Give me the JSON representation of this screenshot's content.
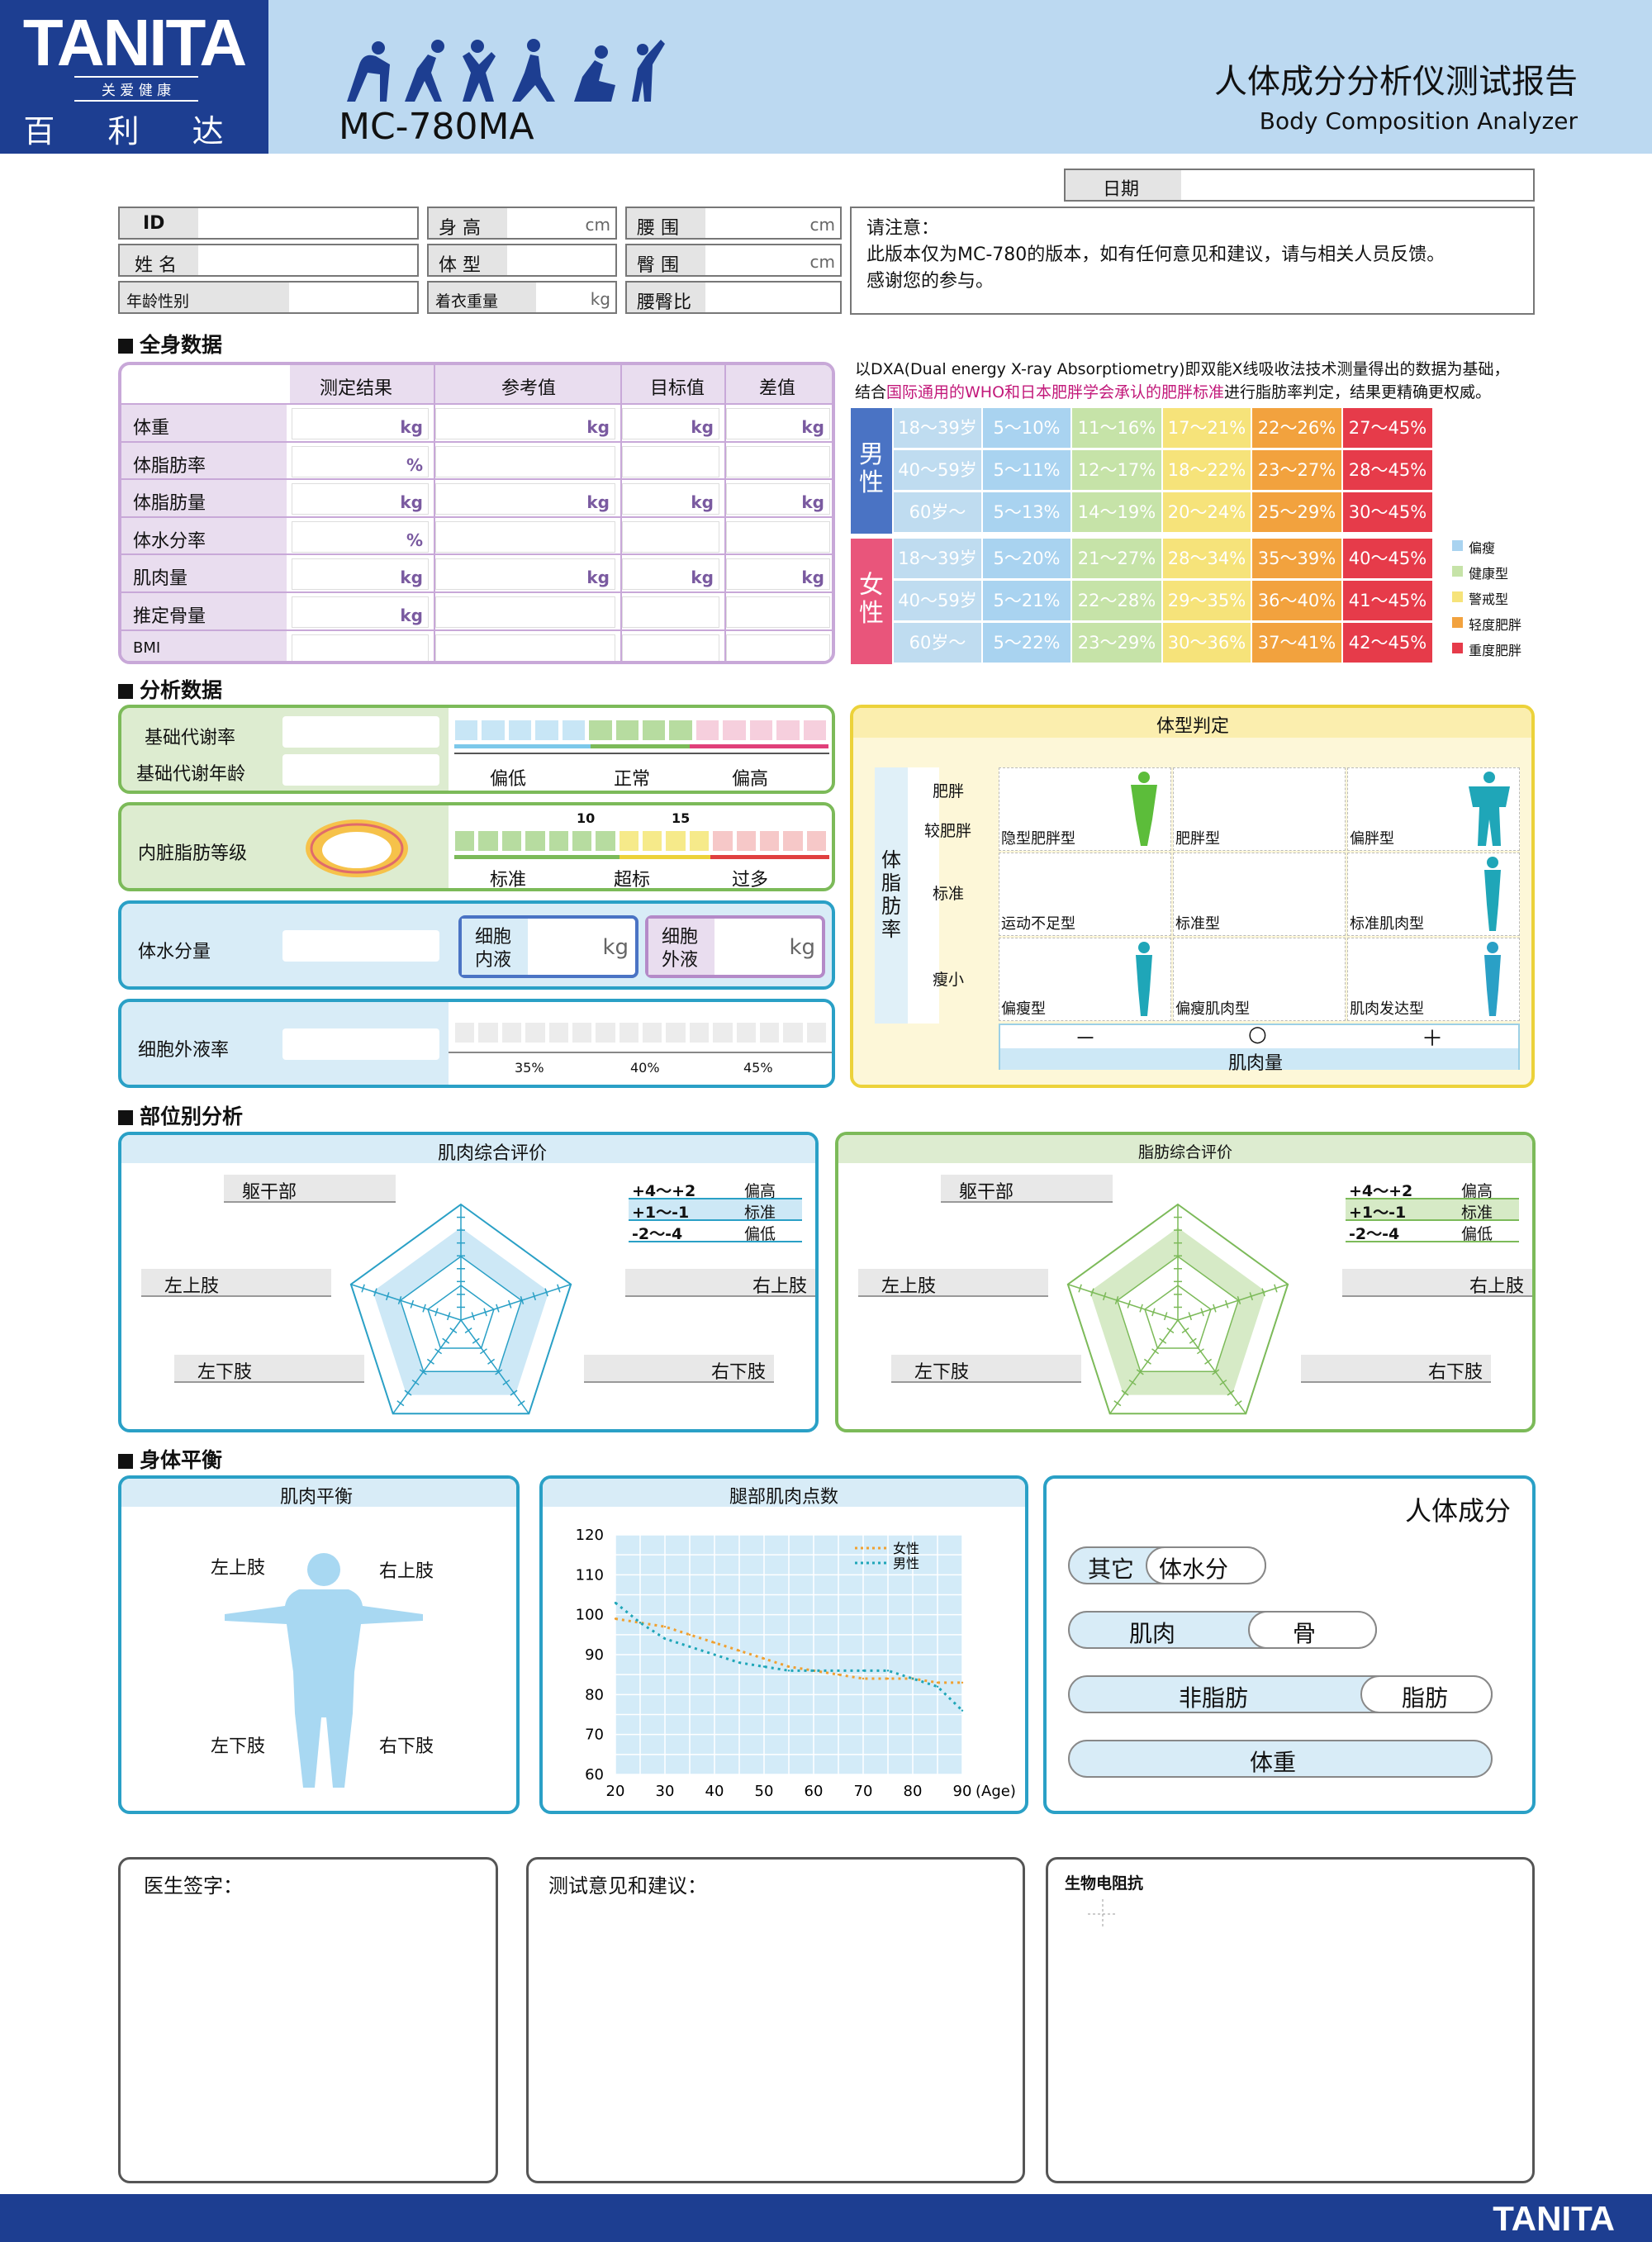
{
  "header": {
    "brand": "TANITA",
    "slogan": "关 爱 健 康",
    "cn_brand": "百 利 达",
    "model": "MC-780MA",
    "title": "人体成分分析仪测试报告",
    "subtitle": "Body Composition Analyzer",
    "footer_brand": "TANITA"
  },
  "colors": {
    "navy": "#1d3e91",
    "header_bg": "#bcd9f1",
    "teal": "#2aa0c6",
    "purple": "#b48ac8",
    "green": "#7cba59",
    "yellow": "#ecd23a",
    "male": "#4a73c4",
    "female": "#e9557b"
  },
  "info": {
    "date": "日期",
    "id": "ID",
    "name": "姓 名",
    "age_sex": "年龄性别",
    "height": "身 高",
    "body_type": "体 型",
    "clothes": "着衣重量",
    "waist": "腰 围",
    "hip": "臀 围",
    "whr": "腰臀比",
    "unit_cm": "cm",
    "unit_kg": "kg",
    "notice": [
      "请注意：",
      "此版本仅为MC-780的版本，如有任何意见和建议，请与相关人员反馈。",
      "感谢您的参与。"
    ]
  },
  "sections": {
    "whole": "全身数据",
    "analysis": "分析数据",
    "segment": "部位别分析",
    "balance": "身体平衡"
  },
  "whole_table": {
    "headers": [
      "测定结果",
      "参考值",
      "目标值",
      "差值"
    ],
    "rows": [
      {
        "label": "体重",
        "units": [
          "kg",
          "kg",
          "kg",
          "kg"
        ]
      },
      {
        "label": "体脂肪率",
        "units": [
          "%",
          "",
          "",
          ""
        ]
      },
      {
        "label": "体脂肪量",
        "units": [
          "kg",
          "kg",
          "kg",
          "kg"
        ]
      },
      {
        "label": "体水分率",
        "units": [
          "%",
          "",
          "",
          ""
        ]
      },
      {
        "label": "肌肉量",
        "units": [
          "kg",
          "kg",
          "kg",
          "kg"
        ]
      },
      {
        "label": "推定骨量",
        "units": [
          "kg",
          "",
          "",
          ""
        ]
      },
      {
        "label": "BMI",
        "units": [
          "",
          "",
          "",
          ""
        ]
      }
    ]
  },
  "dxa": {
    "line1": "以DXA(Dual energy X-ray Absorptiometry)即双能X线吸收法技术测量得出的数据为基础，",
    "line2a": "结合",
    "line2b": "国际通用的WHO和日本肥胖学会承认的肥胖标准",
    "line2c": "进行脂肪率判定，结果更精确更权威。",
    "male": "男性",
    "female": "女性",
    "male_rows": [
      [
        "18～39岁",
        "5～10%",
        "11～16%",
        "17～21%",
        "22～26%",
        "27～45%"
      ],
      [
        "40～59岁",
        "5～11%",
        "12～17%",
        "18～22%",
        "23～27%",
        "28～45%"
      ],
      [
        "60岁～",
        "5～13%",
        "14～19%",
        "20～24%",
        "25～29%",
        "30～45%"
      ]
    ],
    "female_rows": [
      [
        "18～39岁",
        "5～20%",
        "21～27%",
        "28～34%",
        "35～39%",
        "40～45%"
      ],
      [
        "40～59岁",
        "5～21%",
        "22～28%",
        "29～35%",
        "36～40%",
        "41～45%"
      ],
      [
        "60岁～",
        "5～22%",
        "23～29%",
        "30～36%",
        "37～41%",
        "42～45%"
      ]
    ],
    "legend": [
      "偏瘦",
      "健康型",
      "警戒型",
      "轻度肥胖",
      "重度肥胖"
    ],
    "legend_colors": [
      "#a9d3f0",
      "#c6e3a8",
      "#f6e37a",
      "#f2a23e",
      "#e63b4a"
    ],
    "col_colors": [
      "#bfdcf0",
      "#a9d3f0",
      "#c6e3a8",
      "#f6e37a",
      "#f2a23e",
      "#e63b4a"
    ]
  },
  "analysis": {
    "bmr": "基础代谢率",
    "bmr_age": "基础代谢年龄",
    "bmr_scale": [
      "偏低",
      "正常",
      "偏高"
    ],
    "visceral": "内脏脂肪等级",
    "visceral_ticks": [
      "10",
      "15"
    ],
    "visceral_scale": [
      "标准",
      "超标",
      "过多"
    ],
    "water": "体水分量",
    "icw": [
      "细胞",
      "内液"
    ],
    "ecw": [
      "细胞",
      "外液"
    ],
    "unit": "kg",
    "ecw_ratio": "细胞外液率",
    "ecw_ticks": [
      "35%",
      "40%",
      "45%"
    ]
  },
  "body_type": {
    "title": "体型判定",
    "axis_y": [
      "体",
      "脂",
      "肪",
      "率"
    ],
    "rows": [
      "肥胖",
      "较肥胖",
      "标准",
      "瘦小"
    ],
    "cells": [
      "隐型肥胖型",
      "肥胖型",
      "偏胖型",
      "运动不足型",
      "标准型",
      "标准肌肉型",
      "偏瘦型",
      "偏瘦肌肉型",
      "肌肉发达型"
    ],
    "x_marks": [
      "－",
      "○",
      "＋"
    ],
    "x_label": "肌肉量"
  },
  "segment": {
    "muscle_title": "肌肉综合评价",
    "fat_title": "脂肪综合评价",
    "parts": [
      "躯干部",
      "左上肢",
      "右上肢",
      "左下肢",
      "右下肢"
    ],
    "legend": [
      [
        "+4～+2",
        "偏高"
      ],
      [
        "+1～-1",
        "标准"
      ],
      [
        "-2～-4",
        "偏低"
      ]
    ]
  },
  "balance": {
    "title": "肌肉平衡",
    "parts": [
      "左上肢",
      "右上肢",
      "左下肢",
      "右下肢"
    ]
  },
  "leg_chart": {
    "title": "腿部肌肉点数"
  },
  "chart_data": {
    "type": "line",
    "x": [
      20,
      30,
      40,
      50,
      60,
      70,
      80,
      90
    ],
    "xlim": [
      20,
      90
    ],
    "ylim": [
      60,
      120
    ],
    "yticks": [
      60,
      70,
      80,
      90,
      100,
      110,
      120
    ],
    "xlabel": "(Age)",
    "grid": true,
    "legend_position": "top-right",
    "series": [
      {
        "name": "女性",
        "color": "#f0a030",
        "x": [
          20,
          25,
          30,
          35,
          40,
          45,
          50,
          55,
          60,
          65,
          70,
          75,
          80,
          85,
          90
        ],
        "values": [
          99,
          98,
          97,
          95,
          93,
          91,
          89,
          87,
          86,
          85,
          84,
          84,
          84,
          83,
          83
        ]
      },
      {
        "name": "男性",
        "color": "#1fa6b8",
        "x": [
          20,
          25,
          30,
          35,
          40,
          45,
          50,
          55,
          60,
          65,
          70,
          75,
          80,
          85,
          90
        ],
        "values": [
          103,
          98,
          94,
          92,
          90,
          88,
          87,
          86,
          86,
          86,
          86,
          86,
          84,
          82,
          76
        ]
      }
    ]
  },
  "composition": {
    "title": "人体成分",
    "items": [
      "其它",
      "体水分",
      "肌肉",
      "骨",
      "非脂肪",
      "脂肪",
      "体重"
    ]
  },
  "bottom": {
    "doctor": "医生签字：",
    "advice": "测试意见和建议：",
    "bia": "生物电阻抗"
  }
}
